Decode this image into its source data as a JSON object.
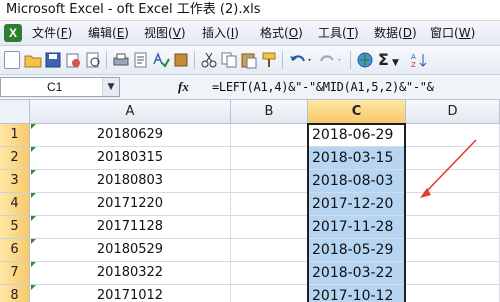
{
  "window": {
    "title": "Microsoft Excel - oft Excel 工作表 (2).xls"
  },
  "menu": {
    "items": [
      {
        "label": "文件(",
        "key": "F",
        "close": ")"
      },
      {
        "label": "编辑(",
        "key": "E",
        "close": ")"
      },
      {
        "label": "视图(",
        "key": "V",
        "close": ")"
      },
      {
        "label": "插入(",
        "key": "I",
        "close": ")"
      },
      {
        "label": "格式(",
        "key": "O",
        "close": ")"
      },
      {
        "label": "工具(",
        "key": "T",
        "close": ")"
      },
      {
        "label": "数据(",
        "key": "D",
        "close": ")"
      },
      {
        "label": "窗口(",
        "key": "W",
        "close": ")"
      }
    ]
  },
  "toolbar": {
    "icons": [
      "new-icon",
      "open-icon",
      "save-icon",
      "permission-icon",
      "print-preview-icon",
      "print-icon",
      "research-icon",
      "spelling-icon",
      "cut-icon",
      "copy-icon",
      "paste-icon",
      "format-painter-icon",
      "undo-icon",
      "redo-icon",
      "hyperlink-icon",
      "autosum-icon"
    ],
    "sum_label": "Σ"
  },
  "formula_bar": {
    "name_box": "C1",
    "fx": "fx",
    "formula": "=LEFT(A1,4)&\"-\"&MID(A1,5,2)&\"-\"&"
  },
  "columns": [
    "A",
    "B",
    "C",
    "D"
  ],
  "rows": [
    {
      "num": "1",
      "a": "20180629",
      "b": "",
      "c": "2018-06-29",
      "d": ""
    },
    {
      "num": "2",
      "a": "20180315",
      "b": "",
      "c": "2018-03-15",
      "d": ""
    },
    {
      "num": "3",
      "a": "20180803",
      "b": "",
      "c": "2018-08-03",
      "d": ""
    },
    {
      "num": "4",
      "a": "20171220",
      "b": "",
      "c": "2017-12-20",
      "d": ""
    },
    {
      "num": "5",
      "a": "20171128",
      "b": "",
      "c": "2017-11-28",
      "d": ""
    },
    {
      "num": "6",
      "a": "20180529",
      "b": "",
      "c": "2018-05-29",
      "d": ""
    },
    {
      "num": "7",
      "a": "20180322",
      "b": "",
      "c": "2018-03-22",
      "d": ""
    },
    {
      "num": "8",
      "a": "20171012",
      "b": "",
      "c": "2017-10-12",
      "d": ""
    }
  ],
  "colors": {
    "selection": "#b6d5f2",
    "arrow": "#e53935",
    "header_selected": "#f7c96a"
  }
}
